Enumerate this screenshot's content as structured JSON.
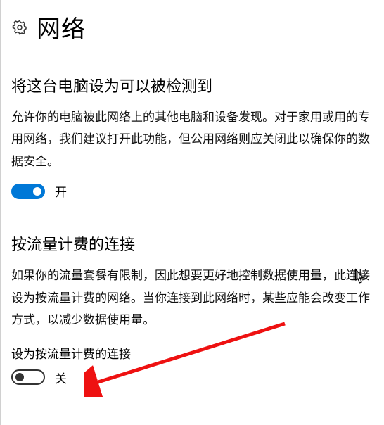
{
  "header": {
    "title": "网络"
  },
  "discoverable": {
    "title": "将这台电脑设为可以被检测到",
    "desc": "允许你的电脑被此网络上的其他电脑和设备发现。对于家用或用的专用网络，我们建议打开此功能，但公用网络则应关闭此以确保你的数据安全。",
    "toggle_state_label": "开"
  },
  "metered": {
    "title": "按流量计费的连接",
    "desc": "如果你的流量套餐有限制，因此想要更好地控制数据使用量，此连接设为按流量计费的网络。当你连接到此网络时，某些应能会改变工作方式，以减少数据使用量。",
    "label": "设为按流量计费的连接",
    "toggle_state_label": "关"
  }
}
